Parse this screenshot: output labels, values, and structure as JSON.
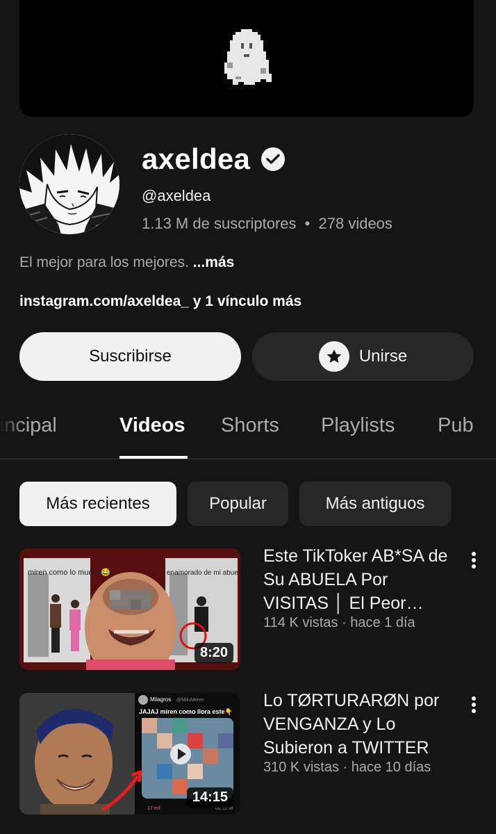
{
  "channel": {
    "name": "axeldea",
    "handle": "@axeldea",
    "subscribers": "1.13 M de suscriptores",
    "stats_separator": "•",
    "videos_count": "278 videos",
    "description": "El mejor para los mejores.",
    "description_more": "...más",
    "links": "instagram.com/axeldea_ y 1 vínculo más"
  },
  "actions": {
    "subscribe_label": "Suscribirse",
    "join_label": "Unirse",
    "join_icon": "star-icon"
  },
  "tabs": [
    {
      "label": "Principal",
      "visible_label": "rincipal",
      "active": false
    },
    {
      "label": "Videos",
      "active": true
    },
    {
      "label": "Shorts",
      "active": false
    },
    {
      "label": "Playlists",
      "active": false
    },
    {
      "label": "Pub",
      "active": false
    }
  ],
  "chips": [
    {
      "label": "Más recientes",
      "active": true
    },
    {
      "label": "Popular",
      "active": false
    },
    {
      "label": "Más antiguos",
      "active": false
    }
  ],
  "videos": [
    {
      "title": "Este TikToker AB*SA de Su ABUELA Por VISITAS │ El Peor Tiktoker",
      "meta": "114 K vistas · hace 1 día",
      "duration": "8:20",
      "thumb_text_1": "miren como lo mueve😂",
      "thumb_text_2": "enamorado de mi abuela😍😍"
    },
    {
      "title": "Lo TØRTURARØN por VENGANZA y Lo Subieron a TWITTER",
      "meta": "310 K vistas · hace 10 días",
      "duration": "14:15",
      "thumb_user": "Milagros",
      "thumb_handle": "@MiluMeren",
      "thumb_caption": "JAJAJ miren como llora este👇",
      "thumb_likes": "17 mil",
      "thumb_date": "dd 12 M"
    }
  ],
  "colors": {
    "background": "#151515",
    "surface": "#272727",
    "text_primary": "#ffffff",
    "text_secondary": "#aaaaaa",
    "button_light": "#f1f1f1"
  }
}
